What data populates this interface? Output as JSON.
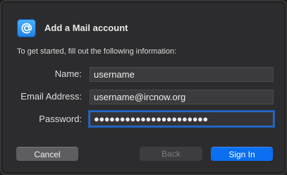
{
  "dialog": {
    "title": "Add a Mail account",
    "subtitle": "To get started, fill out the following information:",
    "app_icon": "at-sign-icon",
    "accent_color": "#0a6ff0"
  },
  "form": {
    "name_label": "Name:",
    "name_value": "username",
    "email_label": "Email Address:",
    "email_value": "username@ircnow.org",
    "password_label": "Password:",
    "password_value": "●●●●●●●●●●●●●●●●●●●●●●"
  },
  "buttons": {
    "cancel_label": "Cancel",
    "back_label": "Back",
    "signin_label": "Sign In"
  }
}
